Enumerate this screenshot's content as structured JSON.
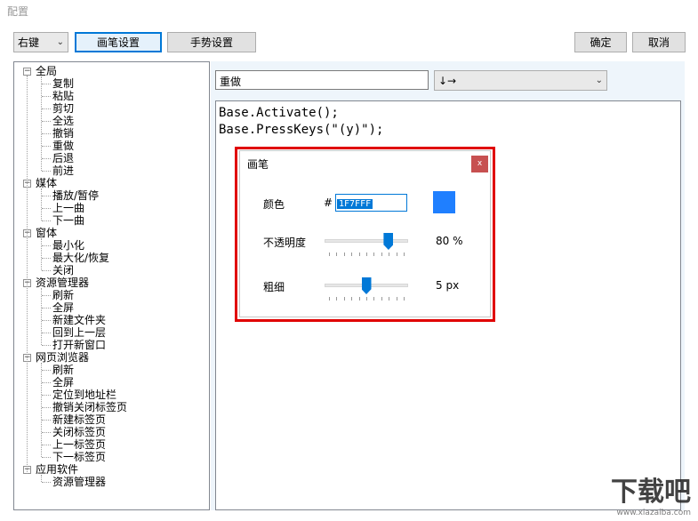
{
  "window": {
    "title": "配置"
  },
  "toolbar": {
    "trigger_select": "右键",
    "tab_pen": "画笔设置",
    "tab_gesture": "手势设置",
    "ok": "确定",
    "cancel": "取消"
  },
  "tree": {
    "groups": [
      {
        "label": "全局",
        "items": [
          "复制",
          "粘贴",
          "剪切",
          "全选",
          "撤销",
          "重做",
          "后退",
          "前进"
        ]
      },
      {
        "label": "媒体",
        "items": [
          "播放/暂停",
          "上一曲",
          "下一曲"
        ]
      },
      {
        "label": "窗体",
        "items": [
          "最小化",
          "最大化/恢复",
          "关闭"
        ]
      },
      {
        "label": "资源管理器",
        "items": [
          "刷新",
          "全屏",
          "新建文件夹",
          "回到上一层",
          "打开新窗口"
        ]
      },
      {
        "label": "网页浏览器",
        "items": [
          "刷新",
          "全屏",
          "定位到地址栏",
          "撤销关闭标签页",
          "新建标签页",
          "关闭标签页",
          "上一标签页",
          "下一标签页"
        ]
      },
      {
        "label": "应用软件",
        "items": [
          "资源管理器"
        ]
      }
    ],
    "toggle_symbol": "−"
  },
  "editor": {
    "name_value": "重做",
    "gesture_select": "↓→",
    "code_lines": [
      "Base.Activate();",
      "Base.PressKeys(\"(y)\");"
    ]
  },
  "pen_dialog": {
    "title": "画笔",
    "close_glyph": "x",
    "color_label": "颜色",
    "hash": "#",
    "color_value": "1F7FFF",
    "swatch_color": "#1F7FFF",
    "opacity_label": "不透明度",
    "opacity_text": "80 %",
    "opacity_fraction": 0.8,
    "width_label": "粗细",
    "width_text": "5 px",
    "width_fraction": 0.5
  },
  "watermark": {
    "text": "下载吧",
    "sub": "www.xiazaiba.com"
  }
}
